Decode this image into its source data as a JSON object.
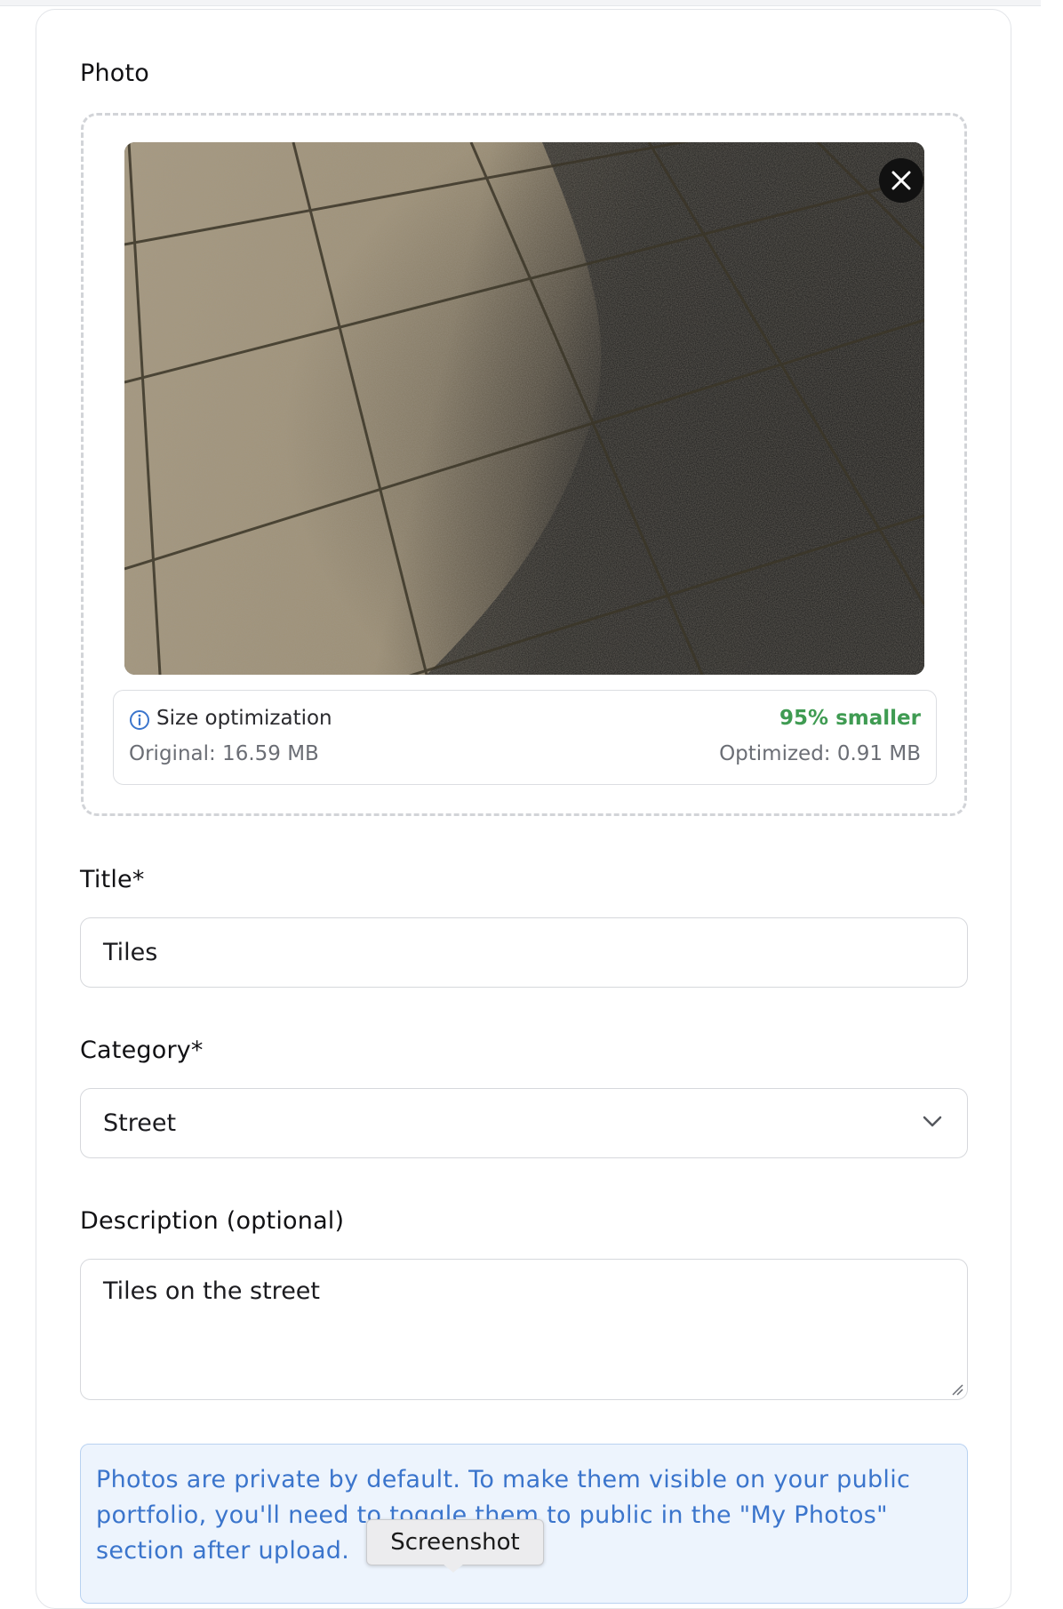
{
  "form": {
    "photo_label": "Photo",
    "title_label": "Title*",
    "title_value": "Tiles",
    "category_label": "Category*",
    "category_value": "Street",
    "description_label": "Description (optional)",
    "description_value": "Tiles on the street"
  },
  "optimization": {
    "title": "Size optimization",
    "savings": "95% smaller",
    "original": "Original: 16.59 MB",
    "optimized": "Optimized: 0.91 MB",
    "savings_color": "#3f9b52"
  },
  "notice": {
    "text": "Photos are private by default. To make them visible on your public portfolio, you'll need to toggle them to public in the \"My Photos\" section after upload."
  },
  "tooltip": {
    "label": "Screenshot"
  },
  "icons": {
    "remove": "close-icon",
    "info": "info-icon",
    "select": "chevron-down-icon"
  },
  "colors": {
    "notice_text": "#3b75cc",
    "notice_bg": "#edf4fd",
    "info_icon": "#3b75cc"
  }
}
